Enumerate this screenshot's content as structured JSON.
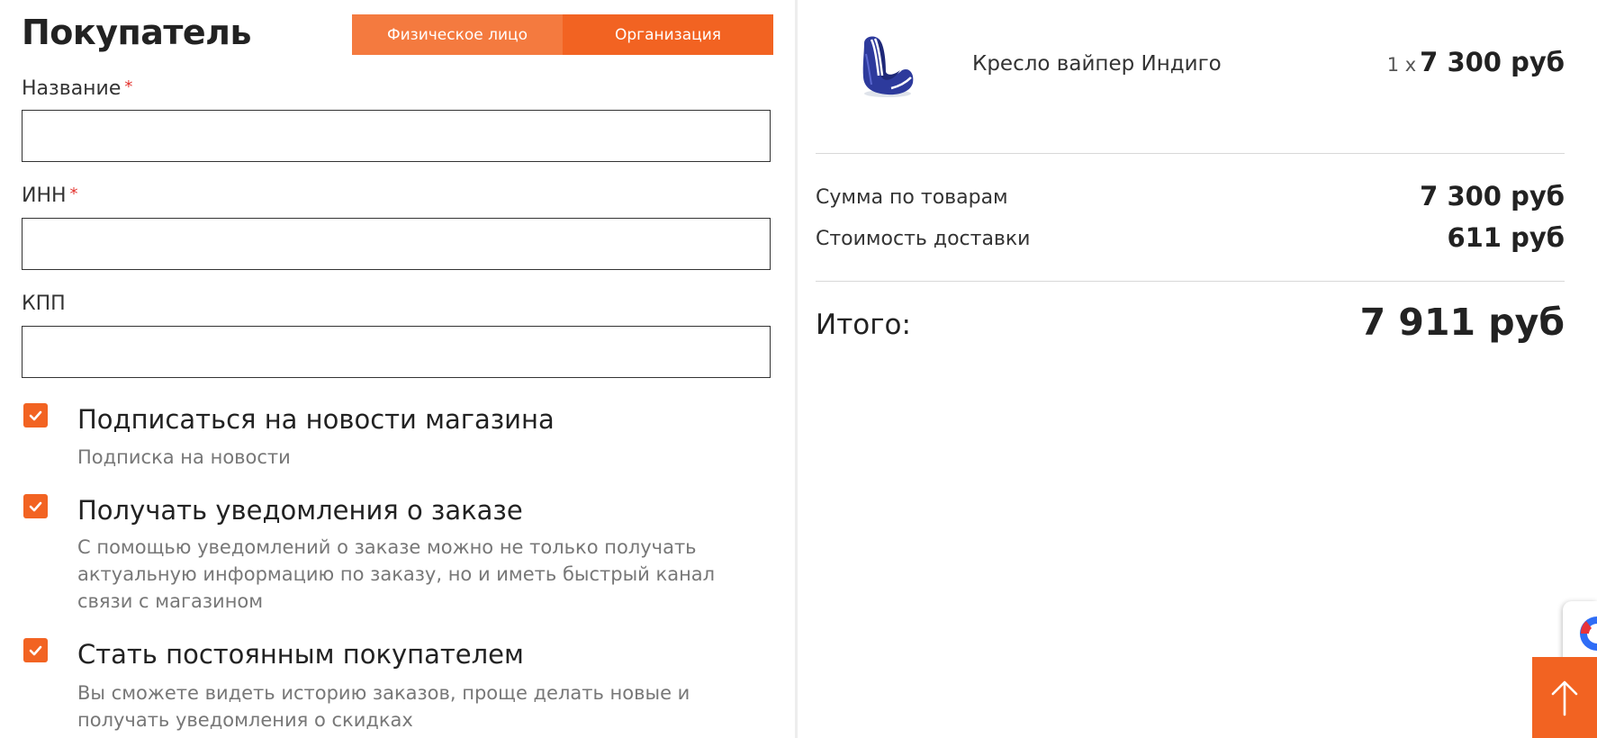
{
  "buyer": {
    "title": "Покупатель",
    "tabs": [
      {
        "label": "Физическое лицо"
      },
      {
        "label": "Организация"
      }
    ],
    "fields": {
      "name": {
        "label": "Название",
        "required_mark": "*",
        "value": ""
      },
      "inn": {
        "label": "ИНН",
        "required_mark": "*",
        "value": ""
      },
      "kpp": {
        "label": "КПП",
        "value": ""
      }
    },
    "options": [
      {
        "title": "Подписаться на новости магазина",
        "description": "Подписка на новости",
        "checked": true
      },
      {
        "title": "Получать уведомления о заказе",
        "description": "С помощью уведомлений о заказе можно не только получать актуальную информацию по заказу, но и иметь быстрый канал связи с магазином",
        "checked": true
      },
      {
        "title": "Стать постоянным покупателем",
        "description": "Вы сможете видеть историю заказов, проще делать новые и получать уведомления о скидках",
        "checked": true
      }
    ]
  },
  "cart": {
    "product": {
      "name": "Кресло вайпер Индиго",
      "quantity": "1 x",
      "price": "7 300 руб"
    },
    "summary": {
      "goods_label": "Сумма по товарам",
      "goods_value": "7 300 руб",
      "delivery_label": "Стоимость доставки",
      "delivery_value": "611 руб"
    },
    "total": {
      "label": "Итого:",
      "value": "7 911 руб"
    }
  },
  "colors": {
    "accent": "#f26322",
    "accent_light": "#f47a3f",
    "required": "#e3342f"
  },
  "icons": {
    "checkbox": "check-icon",
    "scroll_top": "arrow-up-icon",
    "chat": "chat-widget-icon"
  }
}
